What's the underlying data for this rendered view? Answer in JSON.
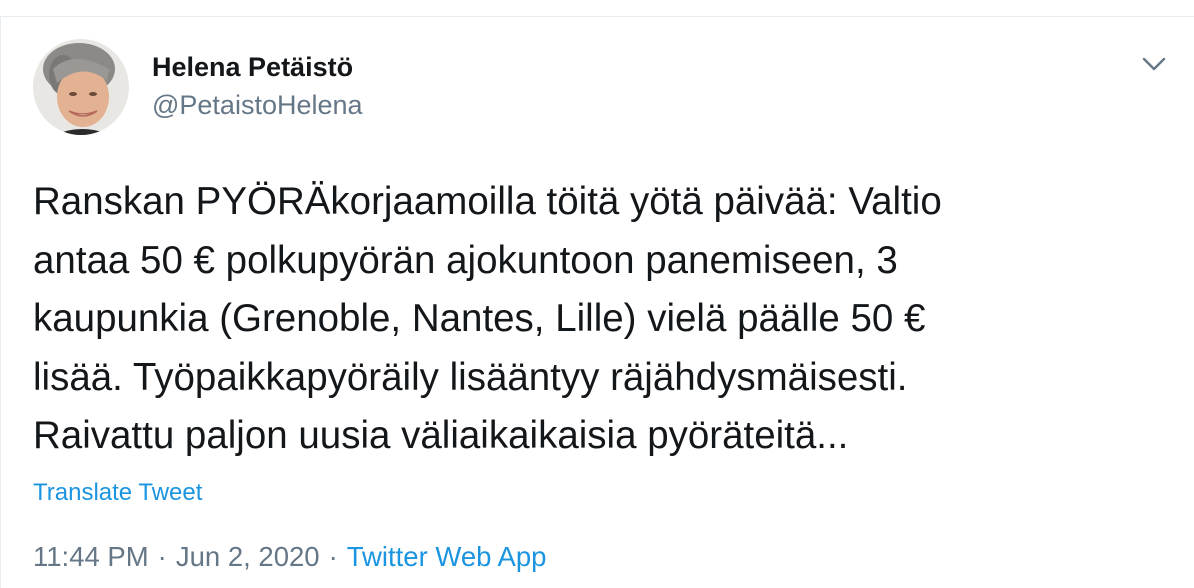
{
  "author": {
    "display_name": "Helena Petäistö",
    "handle": "@PetaistoHelena"
  },
  "icons": {
    "avatar": "profile-photo",
    "menu": "chevron-down-icon"
  },
  "tweet": {
    "text_lines": [
      "Ranskan PYÖRÄkorjaamoilla töitä yötä päivää: Valtio",
      "antaa 50 € polkupyörän ajokuntoon panemiseen, 3",
      "kaupunkia (Grenoble, Nantes, Lille) vielä päälle 50 €",
      "lisää. Työpaikkapyöräily lisääntyy räjähdysmäisesti.",
      "Raivattu paljon uusia väliaikaikaisia pyöräteitä..."
    ],
    "translate_label": "Translate Tweet"
  },
  "meta": {
    "time": "11:44 PM",
    "separator": "·",
    "date": "Jun 2, 2020",
    "source": "Twitter Web App"
  },
  "colors": {
    "text": "#14171a",
    "secondary": "#657786",
    "link": "#1b95e0",
    "divider": "#e6ecf0"
  }
}
